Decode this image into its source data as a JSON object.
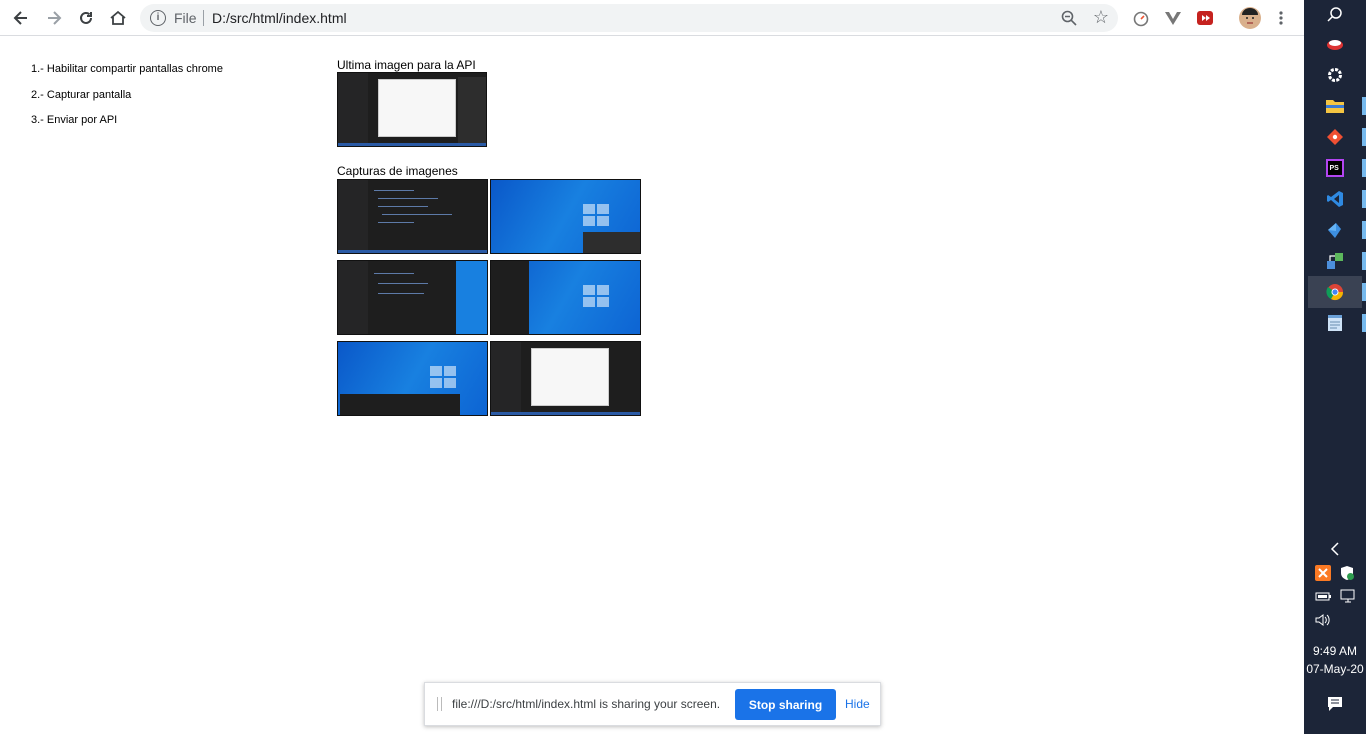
{
  "browser": {
    "address_scheme": "File",
    "address_url": "D:/src/html/index.html"
  },
  "page": {
    "steps": [
      "1.- Habilitar compartir pantallas chrome",
      "2.- Capturar pantalla",
      "3.- Enviar por API"
    ],
    "last_image_label": "Ultima imagen para la API",
    "captures_label": "Capturas de imagenes"
  },
  "sharing_bar": {
    "message": "file:///D:/src/html/index.html is sharing your screen.",
    "stop_label": "Stop sharing",
    "hide_label": "Hide"
  },
  "taskbar": {
    "time": "9:49 AM",
    "date": "07-May-20",
    "pinned": [
      "snipping-icon",
      "settings-icon",
      "file-explorer-icon",
      "git-icon",
      "phpstorm-icon",
      "vscode-icon",
      "kite-icon",
      "network-app-icon",
      "chrome-icon",
      "notepad-icon"
    ]
  },
  "colors": {
    "accent": "#1a73e8",
    "taskbar_bg": "#1c2538",
    "desktop_blue": "#1880e0"
  }
}
